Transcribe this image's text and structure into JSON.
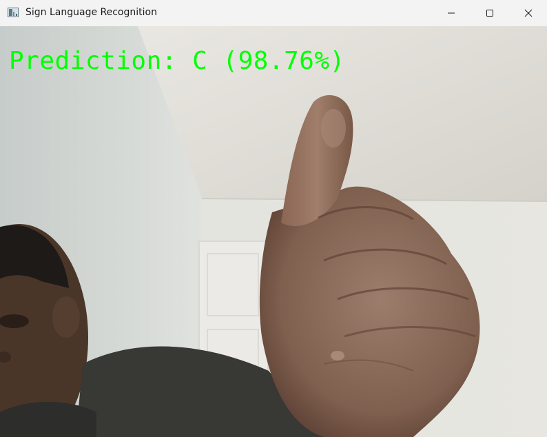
{
  "window": {
    "title": "Sign Language Recognition",
    "controls": {
      "minimize_icon": "minimize-icon",
      "maximize_icon": "maximize-icon",
      "close_icon": "close-icon"
    }
  },
  "video": {
    "overlay_text": "Prediction: C (98.76%)",
    "overlay_color": "#00ff00"
  }
}
